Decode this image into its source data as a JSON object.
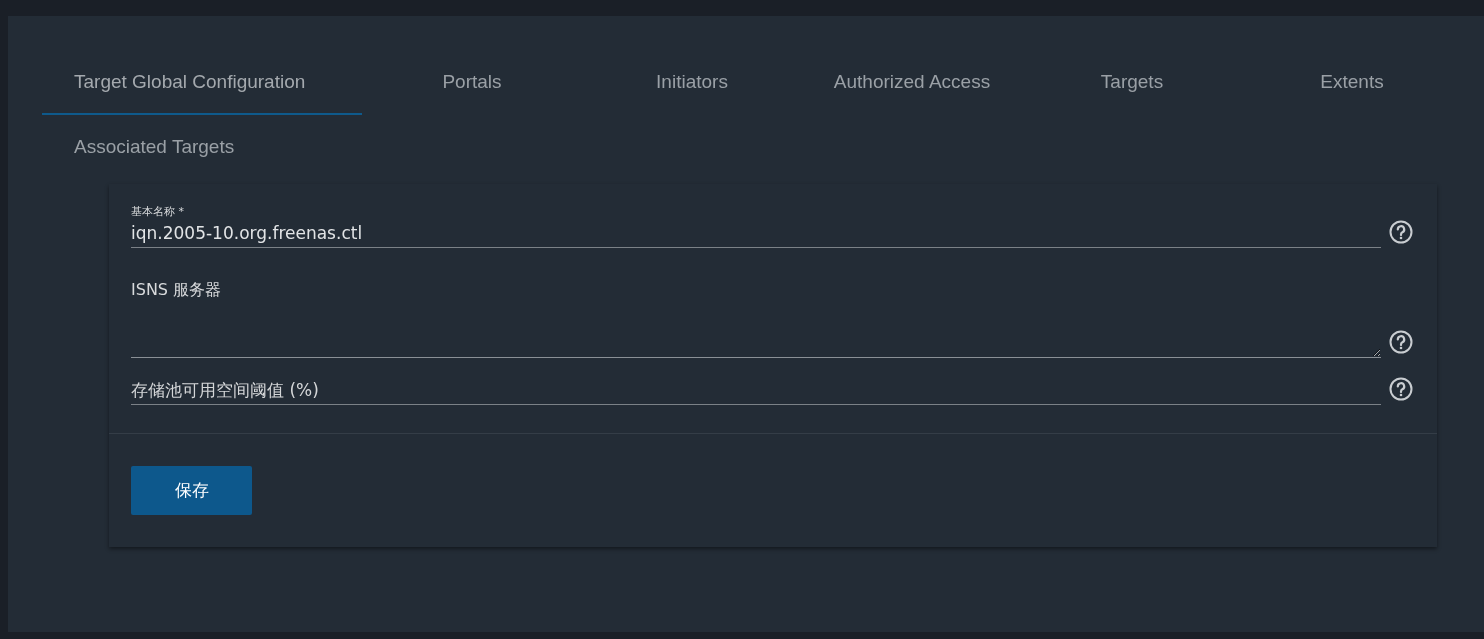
{
  "tabs": [
    {
      "label": "Target Global Configuration",
      "selected": true
    },
    {
      "label": "Portals",
      "selected": false
    },
    {
      "label": "Initiators",
      "selected": false
    },
    {
      "label": "Authorized Access",
      "selected": false
    },
    {
      "label": "Targets",
      "selected": false
    },
    {
      "label": "Extents",
      "selected": false
    },
    {
      "label": "Associated Targets",
      "selected": false
    }
  ],
  "fields": [
    {
      "kind": "input",
      "label": "基本名称 *",
      "value": "iqn.2005-10.org.freenas.ctl"
    },
    {
      "kind": "textarea",
      "label": "ISNS 服务器"
    },
    {
      "kind": "input",
      "placeholder": "存储池可用空间阈值 (%)"
    }
  ],
  "buttons": [
    "保存"
  ]
}
